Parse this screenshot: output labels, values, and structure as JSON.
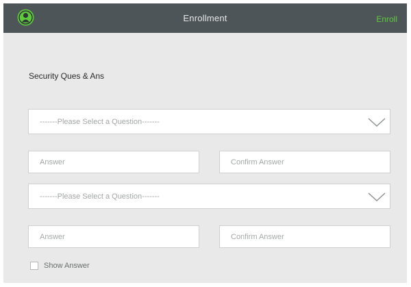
{
  "header": {
    "title": "Enrollment",
    "enroll_label": "Enroll",
    "logo_icon": "user-avatar-icon"
  },
  "colors": {
    "header_bg": "#4e5558",
    "accent_green": "#5dcb3c",
    "panel_bg": "#e8e9e8"
  },
  "form": {
    "section_title": "Security Ques & Ans",
    "question_1": {
      "selected": "-------Please Select a Question-------",
      "answer_placeholder": "Answer",
      "confirm_placeholder": "Confirm Answer"
    },
    "question_2": {
      "selected": "-------Please Select a Question-------",
      "answer_placeholder": "Answer",
      "confirm_placeholder": "Confirm Answer"
    },
    "show_answer_label": "Show Answer",
    "show_answer_checked": false
  }
}
